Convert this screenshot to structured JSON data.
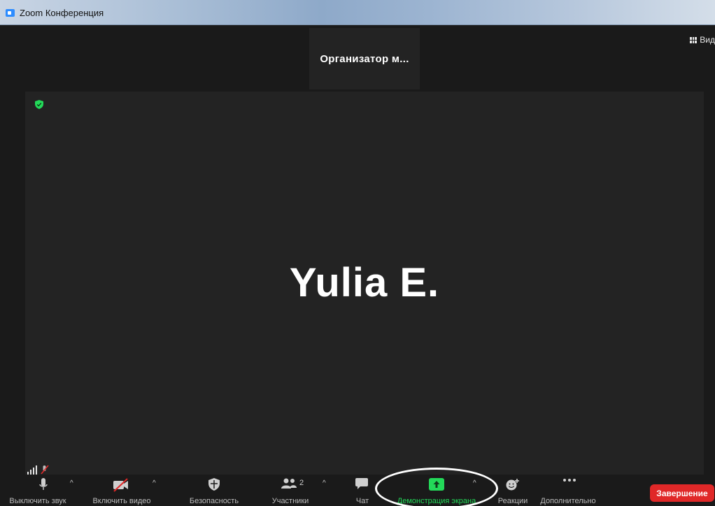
{
  "window": {
    "title": "Zoom Конференция",
    "icon": "zoom-app-icon"
  },
  "top": {
    "thumbnail_name": "Организатор м...",
    "view_label": "Вид",
    "view_icon": "grid-icon"
  },
  "main": {
    "participant_name": "Yulia E.",
    "encryption_icon": "green-shield-icon",
    "signal_icon": "signal-bars-icon",
    "muted_mic_icon": "mic-muted-icon"
  },
  "toolbar": {
    "mute": {
      "label": "Выключить звук",
      "icon": "microphone-icon"
    },
    "video": {
      "label": "Включить видео",
      "icon": "video-off-icon"
    },
    "security": {
      "label": "Безопасность",
      "icon": "shield-icon"
    },
    "participants": {
      "label": "Участники",
      "icon": "participants-icon",
      "count": "2"
    },
    "chat": {
      "label": "Чат",
      "icon": "chat-icon"
    },
    "share": {
      "label": "Демонстрация экрана",
      "icon": "share-screen-icon",
      "color": "#23d959"
    },
    "reactions": {
      "label": "Реакции",
      "icon": "emoji-add-icon"
    },
    "more": {
      "label": "Дополнительно",
      "icon": "more-dots-icon"
    },
    "end": {
      "label": "Завершение",
      "color": "#e02828"
    }
  }
}
